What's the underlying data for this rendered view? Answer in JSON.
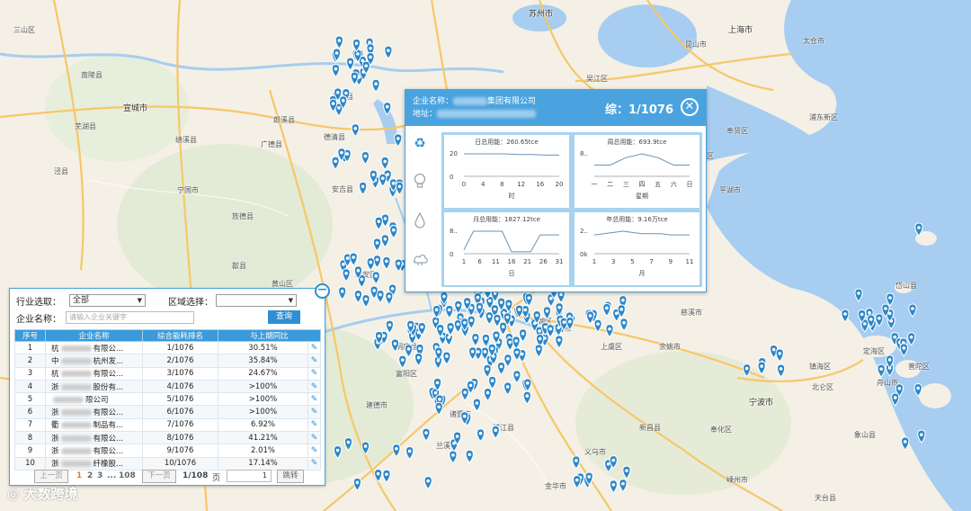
{
  "popup": {
    "company_label": "企业名称：",
    "company_name_suffix": "集团有限公司",
    "address_label": "地址：",
    "rank": "综：1/1076",
    "close": "✕",
    "charts": [
      {
        "title": "日总用能：260.65tce",
        "xlabel": "时",
        "xticks": [
          "0",
          "4",
          "8",
          "12",
          "16",
          "20"
        ],
        "yticks": [
          "20",
          "0"
        ],
        "values": [
          18,
          18,
          18,
          18,
          17.5,
          17.5,
          17,
          17
        ]
      },
      {
        "title": "周总用能：693.9tce",
        "xlabel": "星期",
        "xticks": [
          "一",
          "二",
          "三",
          "四",
          "五",
          "六",
          "日"
        ],
        "yticks": [
          "8..",
          ""
        ],
        "values": [
          3,
          3,
          5,
          6,
          5,
          3,
          3
        ]
      },
      {
        "title": "月总用能：1827.12tce",
        "xlabel": "日",
        "xticks": [
          "1",
          "6",
          "11",
          "16",
          "21",
          "26",
          "31"
        ],
        "yticks": [
          "8..",
          "0"
        ],
        "values": [
          1,
          6,
          6,
          6,
          6,
          0.5,
          0.5,
          0.5,
          5,
          5,
          5
        ]
      },
      {
        "title": "年总用能：9.16万tce",
        "xlabel": "月",
        "xticks": [
          "1",
          "3",
          "5",
          "7",
          "9",
          "11"
        ],
        "yticks": [
          "2..",
          "0k"
        ],
        "values": [
          1.5,
          1.6,
          1.7,
          1.8,
          1.7,
          1.6,
          1.6,
          1.6,
          1.5,
          1.5,
          1.5
        ]
      }
    ]
  },
  "panel": {
    "industry_label": "行业选取：",
    "industry_value": "全部",
    "region_label": "区域选择：",
    "region_value": "",
    "name_label": "企业名称：",
    "name_placeholder": "请输入企业关键字",
    "query_button": "查询",
    "columns": [
      "序号",
      "企业名称",
      "综合能耗排名",
      "与上期同比"
    ],
    "rows": [
      {
        "no": "1",
        "pre": "杭",
        "suf": "有限公...",
        "rank": "1/1076",
        "cmp": "30.51%"
      },
      {
        "no": "2",
        "pre": "中",
        "suf": "杭州发...",
        "rank": "2/1076",
        "cmp": "35.84%"
      },
      {
        "no": "3",
        "pre": "杭",
        "suf": "有限公...",
        "rank": "3/1076",
        "cmp": "24.67%"
      },
      {
        "no": "4",
        "pre": "浙",
        "suf": "股份有...",
        "rank": "4/1076",
        "cmp": ">100%"
      },
      {
        "no": "5",
        "pre": "",
        "suf": "限公司",
        "rank": "5/1076",
        "cmp": ">100%"
      },
      {
        "no": "6",
        "pre": "浙",
        "suf": "有限公...",
        "rank": "6/1076",
        "cmp": ">100%"
      },
      {
        "no": "7",
        "pre": "衢",
        "suf": "制品有...",
        "rank": "7/1076",
        "cmp": "6.92%"
      },
      {
        "no": "8",
        "pre": "浙",
        "suf": "有限公...",
        "rank": "8/1076",
        "cmp": "41.21%"
      },
      {
        "no": "9",
        "pre": "浙",
        "suf": "有限公...",
        "rank": "9/1076",
        "cmp": "2.01%"
      },
      {
        "no": "10",
        "pre": "浙",
        "suf": "纤橡股...",
        "rank": "10/1076",
        "cmp": "17.14%"
      }
    ],
    "pager": {
      "prev": "上一页",
      "pages": [
        "1",
        "2",
        "3",
        "...",
        "108"
      ],
      "next": "下一页",
      "total": "1/108",
      "page_word": "页",
      "jump_value": "1",
      "jump": "跳转"
    }
  },
  "map_labels": [
    {
      "t": "苏州市",
      "big": true
    },
    {
      "t": "上海市",
      "big": true
    },
    {
      "t": "宣城市",
      "big": true
    },
    {
      "t": "宁国市"
    },
    {
      "t": "安吉县"
    },
    {
      "t": "泾县"
    },
    {
      "t": "旌德县"
    },
    {
      "t": "湖州市"
    },
    {
      "t": "嘉兴市"
    },
    {
      "t": "绍兴市"
    },
    {
      "t": "宁波市",
      "big": true
    },
    {
      "t": "慈溪市"
    },
    {
      "t": "余姚市"
    },
    {
      "t": "上虞区"
    },
    {
      "t": "奉化区"
    },
    {
      "t": "定海区"
    },
    {
      "t": "普陀区"
    },
    {
      "t": "岱山县"
    },
    {
      "t": "北仑区"
    },
    {
      "t": "新昌县"
    },
    {
      "t": "嵊州市"
    },
    {
      "t": "天台县"
    },
    {
      "t": "象山县"
    },
    {
      "t": "桐庐县"
    },
    {
      "t": "淳安县"
    },
    {
      "t": "建德市"
    },
    {
      "t": "兰溪市"
    },
    {
      "t": "浦江县"
    },
    {
      "t": "金华市"
    },
    {
      "t": "义乌市"
    },
    {
      "t": "太仓市"
    },
    {
      "t": "昆山市"
    },
    {
      "t": "平湖市"
    },
    {
      "t": "海宁市"
    },
    {
      "t": "桐乡市"
    },
    {
      "t": "德清县"
    },
    {
      "t": "长兴县"
    },
    {
      "t": "广德县"
    },
    {
      "t": "郎溪县"
    },
    {
      "t": "南陵县"
    },
    {
      "t": "芜湖县"
    },
    {
      "t": "绩溪县"
    },
    {
      "t": "歙县"
    },
    {
      "t": "黄山区"
    },
    {
      "t": "临安区"
    },
    {
      "t": "富阳区"
    },
    {
      "t": "诸暨市"
    },
    {
      "t": "青浦区"
    },
    {
      "t": "松江区"
    },
    {
      "t": "金山区"
    },
    {
      "t": "奉贤区"
    },
    {
      "t": "浦东新区"
    },
    {
      "t": "吴江区"
    },
    {
      "t": "嘉善县"
    },
    {
      "t": "海盐县"
    },
    {
      "t": "南湖区"
    },
    {
      "t": "三山区"
    },
    {
      "t": "繁昌县"
    },
    {
      "t": "舟山市"
    },
    {
      "t": "镇海区"
    }
  ],
  "watermark": "大数跨境"
}
